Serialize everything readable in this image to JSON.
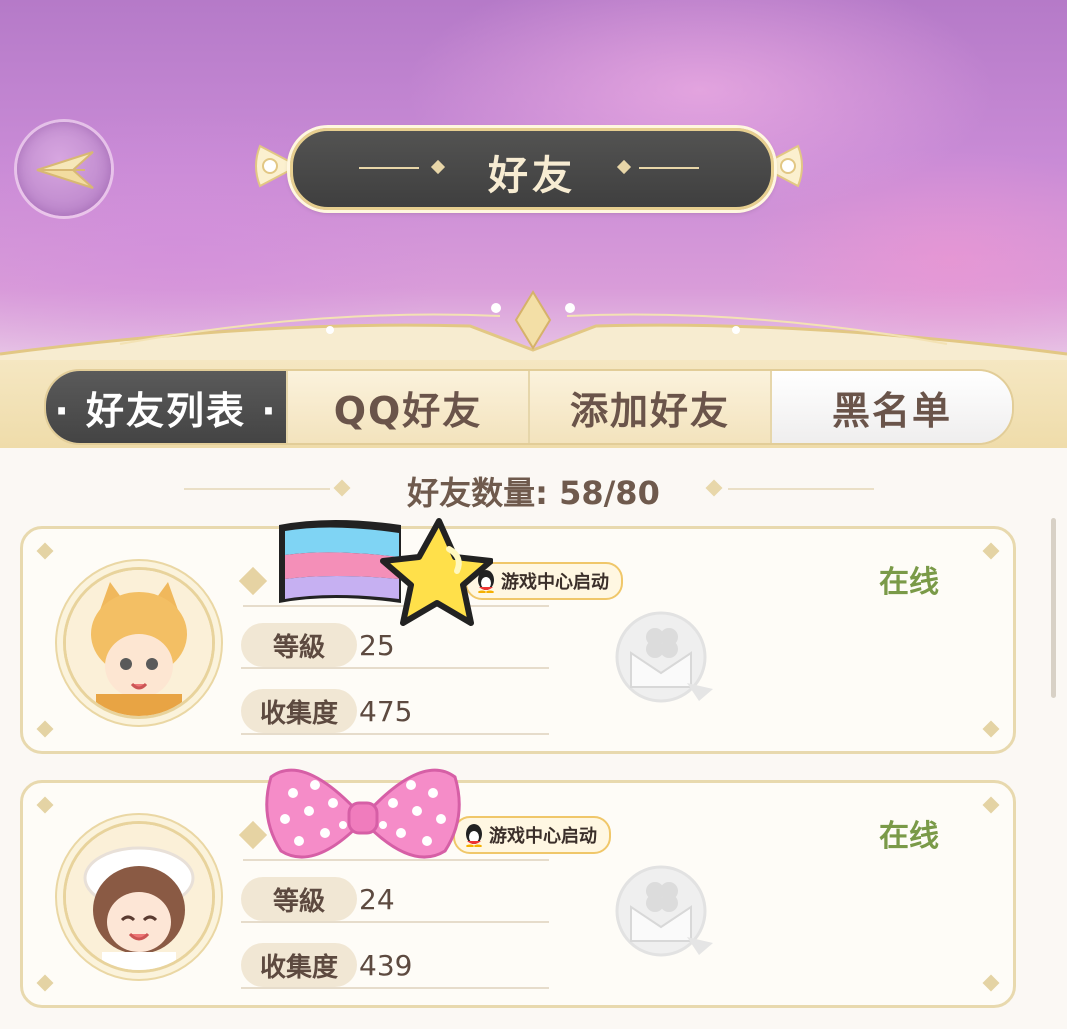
{
  "header": {
    "title": "好友"
  },
  "tabs": [
    {
      "label": "· 好友列表 ·",
      "active": true
    },
    {
      "label": "QQ好友",
      "active": false
    },
    {
      "label": "添加好友",
      "active": false
    },
    {
      "label": "黑名单",
      "active": false
    }
  ],
  "friend_count": {
    "text": "好友数量: 58/80",
    "current": 58,
    "max": 80
  },
  "friends": [
    {
      "badge": "游戏中心启动",
      "level_label": "等級",
      "level": "25",
      "collection_label": "收集度",
      "collection": "475",
      "status": "在线",
      "avatar": "cat-ear-boy-avatar",
      "sticker": "shooting-star-sticker"
    },
    {
      "badge": "游戏中心启动",
      "level_label": "等級",
      "level": "24",
      "collection_label": "收集度",
      "collection": "439",
      "status": "在线",
      "avatar": "maid-girl-avatar",
      "sticker": "pink-polka-bow-sticker"
    }
  ],
  "colors": {
    "online": "#7a9a48",
    "tab_active": "#4a4a4a",
    "gold_trim": "#e8d39c",
    "header_purple": "#c98bd6"
  },
  "icons": [
    "back-wing-icon",
    "qq-penguin-icon",
    "clover-gift-icon"
  ]
}
